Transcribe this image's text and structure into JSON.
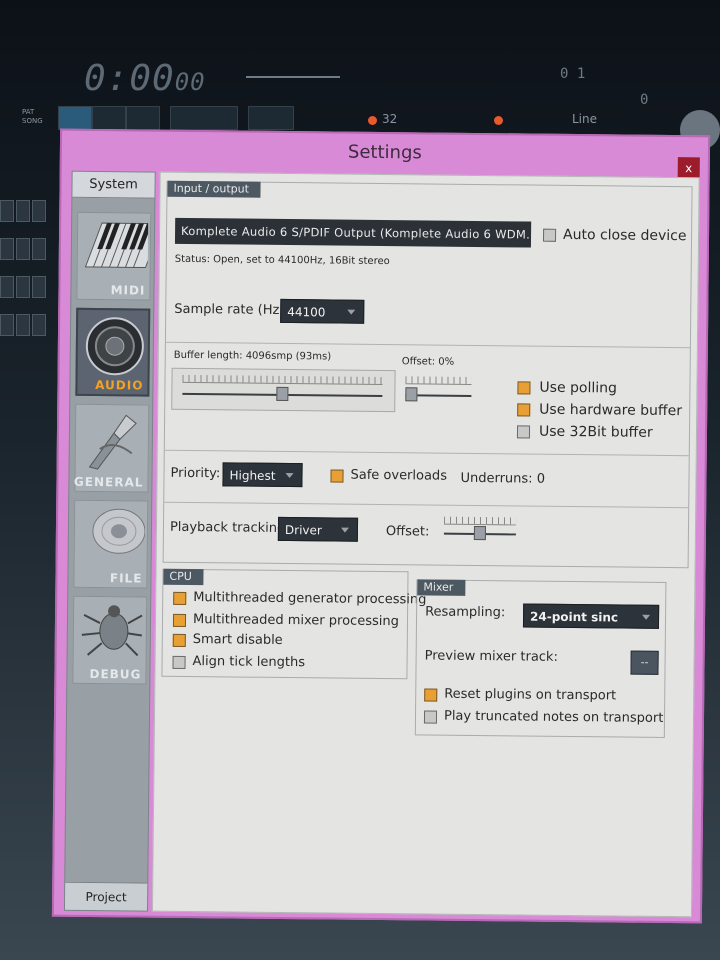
{
  "background": {
    "time": "0:00",
    "time_small": "00",
    "counter_right": "0 1",
    "counter_right2": "0",
    "pat_label": "PAT",
    "song_label": "SONG",
    "tempo_digits": "32",
    "line_label": "Line"
  },
  "window": {
    "title": "Settings",
    "close_label": "x"
  },
  "sidebar": {
    "top_tab": "System",
    "items": [
      {
        "label": "MIDI",
        "icon": "keyboard-icon"
      },
      {
        "label": "AUDIO",
        "icon": "speaker-icon"
      },
      {
        "label": "GENERAL",
        "icon": "wrench-icon"
      },
      {
        "label": "FILE",
        "icon": "disc-icon"
      },
      {
        "label": "DEBUG",
        "icon": "bug-icon"
      }
    ],
    "bottom_tab": "Project",
    "active": "AUDIO"
  },
  "io": {
    "section_title": "Input / output",
    "device": "Komplete Audio 6 S/PDIF Output (Komplete Audio 6 WDM.",
    "auto_close_label": "Auto close device",
    "status": "Status:  Open, set to 44100Hz, 16Bit stereo",
    "sample_rate_label": "Sample rate (Hz):",
    "sample_rate_value": "44100",
    "buffer_length_label": "Buffer length: 4096smp (93ms)",
    "offset_label": "Offset: 0%",
    "use_polling": "Use polling",
    "use_hw_buffer": "Use hardware buffer",
    "use_32bit": "Use 32Bit buffer",
    "priority_label": "Priority:",
    "priority_value": "Highest",
    "safe_overloads": "Safe overloads",
    "underruns": "Underruns: 0",
    "playback_label": "Playback tracking:",
    "playback_value": "Driver",
    "playback_offset_label": "Offset:"
  },
  "cpu": {
    "section_title": "CPU",
    "items": [
      "Multithreaded generator processing",
      "Multithreaded mixer processing",
      "Smart disable",
      "Align tick lengths"
    ]
  },
  "mixer": {
    "section_title": "Mixer",
    "resampling_label": "Resampling:",
    "resampling_value": "24-point sinc",
    "preview_label": "Preview mixer track:",
    "preview_value": "--",
    "reset_plugins": "Reset plugins on transport",
    "play_truncated": "Play truncated notes on transport"
  },
  "colors": {
    "window_frame": "#d88ad6",
    "accent_orange": "#e8a034",
    "close_red": "#9c1c2c"
  }
}
